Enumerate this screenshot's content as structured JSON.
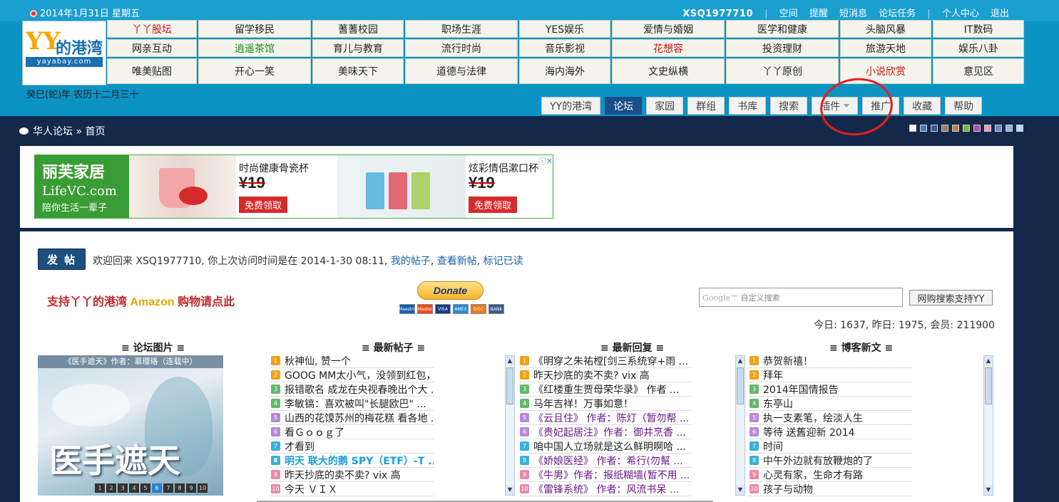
{
  "header": {
    "date": "2014年1月31日 星期五",
    "lunar": "癸巳(蛇)年 农历十二月三十",
    "username": "XSQ1977710",
    "top_links": [
      "空间",
      "提醒",
      "短消息",
      "论坛任务"
    ],
    "top_links2": [
      "个人中心",
      "退出"
    ],
    "logo": {
      "mark": "YY",
      "text": "的港湾",
      "domain": "yayabay.com"
    }
  },
  "categories": [
    {
      "label": "丫丫股坛",
      "color": "red"
    },
    {
      "label": "留学移民",
      "color": "normal"
    },
    {
      "label": "蓍蓍校园",
      "color": "normal"
    },
    {
      "label": "职场生涯",
      "color": "normal"
    },
    {
      "label": "YES娱乐",
      "color": "normal"
    },
    {
      "label": "爱情与婚姻",
      "color": "normal"
    },
    {
      "label": "医学和健康",
      "color": "normal"
    },
    {
      "label": "头脑风暴",
      "color": "normal"
    },
    {
      "label": "IT数码",
      "color": "normal"
    },
    {
      "label": "网亲互动",
      "color": "normal"
    },
    {
      "label": "逍遥茶馆",
      "color": "green"
    },
    {
      "label": "育儿与教育",
      "color": "normal"
    },
    {
      "label": "流行时尚",
      "color": "normal"
    },
    {
      "label": "音乐影视",
      "color": "normal"
    },
    {
      "label": "花想容",
      "color": "red"
    },
    {
      "label": "投资理财",
      "color": "normal"
    },
    {
      "label": "旅游天地",
      "color": "normal"
    },
    {
      "label": "娱乐八卦",
      "color": "normal"
    },
    {
      "label": "唯美贴图",
      "color": "normal"
    },
    {
      "label": "开心一笑",
      "color": "normal"
    },
    {
      "label": "美味天下",
      "color": "normal"
    },
    {
      "label": "道德与法律",
      "color": "normal"
    },
    {
      "label": "海内海外",
      "color": "normal"
    },
    {
      "label": "文史纵横",
      "color": "normal"
    },
    {
      "label": "丫丫原创",
      "color": "normal"
    },
    {
      "label": "小说欣赏",
      "color": "red"
    },
    {
      "label": "意见区",
      "color": "normal"
    }
  ],
  "nav_tabs": [
    {
      "label": "YY的港湾",
      "active": false
    },
    {
      "label": "论坛",
      "active": true
    },
    {
      "label": "家园",
      "active": false
    },
    {
      "label": "群组",
      "active": false
    },
    {
      "label": "书库",
      "active": false
    },
    {
      "label": "搜索",
      "active": false
    },
    {
      "label": "插件",
      "active": false,
      "dropdown": true
    },
    {
      "label": "推广",
      "active": false
    },
    {
      "label": "收藏",
      "active": false
    },
    {
      "label": "帮助",
      "active": false
    }
  ],
  "breadcrumb": {
    "forum": "华人论坛",
    "sep": "»",
    "page": "首页"
  },
  "style_swatches": [
    "#ffffff",
    "#4a78b8",
    "#3a5a8a",
    "#9a7a5a",
    "#c08040",
    "#7ab830",
    "#b848a8",
    "#e89ab8",
    "#6a8ac8",
    "#8ab8e8",
    "#b8d8f0"
  ],
  "ad": {
    "brand1": "丽芙家居",
    "brand2": "LifeVC.com",
    "slogan": "陪你生活一辈子",
    "item1_title": "时尚健康骨瓷杯",
    "item1_price": "¥19",
    "item2_title": "炫彩情侣漱口杯",
    "item2_price": "¥19",
    "cta": "免费领取",
    "close": "ⓘ✕"
  },
  "welcome": {
    "post_button": "发 帖",
    "text": "欢迎回来 XSQ1977710, 你上次访问时间是在 2014-1-30 08:11,",
    "link_my_posts": "我的帖子",
    "link_new_posts": "查看新帖",
    "link_mark_read": "标记已读"
  },
  "promo": {
    "part1": "支持丫丫的港湾 ",
    "part2": "Amazon",
    "part3": " 购物请点此"
  },
  "donate": {
    "label": "Donate",
    "cards": [
      "Maestro",
      "Master",
      "VISA",
      "AMEX",
      "DISC",
      "BANK"
    ]
  },
  "gsearch": {
    "brand": "Google™",
    "placeholder": "自定义搜索",
    "button": "网购搜索支持YY"
  },
  "stats": "今日: 1637, 昨日: 1975, 会员: 211900",
  "columns": {
    "pics_title": "≡ 论坛图片 ≡",
    "new_posts_title": "≡ 最新帖子 ≡",
    "new_replies_title": "≡ 最新回复 ≡",
    "blog_title": "≡ 博客新文 ≡"
  },
  "pic": {
    "caption": "《医手遮天》作者：慕璎珞（连载中）",
    "title": "医手遮天",
    "pages": [
      "1",
      "2",
      "3",
      "4",
      "5",
      "6",
      "7",
      "8",
      "9",
      "10"
    ],
    "active_page": 6
  },
  "num_colors": [
    "#f2a11a",
    "#f2a11a",
    "#65b86a",
    "#65b86a",
    "#b88ad8",
    "#b88ad8",
    "#3ab0d8",
    "#3ab0d8",
    "#e88aa8",
    "#e88aa8"
  ],
  "new_posts": [
    {
      "n": "1",
      "text": "秋神仙,   赞一个",
      "style": "normal"
    },
    {
      "n": "2",
      "text": "GOOG MM太小气，没领到红包，给 ...",
      "style": "normal"
    },
    {
      "n": "3",
      "text": "报错歌名 成龙在央视春晚出个大 ...",
      "style": "normal"
    },
    {
      "n": "4",
      "text": "李敏镐：喜欢被叫\"长腿欧巴\" ...",
      "style": "normal"
    },
    {
      "n": "5",
      "text": "山西的花馍苏州的梅花糕 看各地 ...",
      "style": "normal"
    },
    {
      "n": "6",
      "text": "看Ｇｏｏｇ了",
      "style": "normal"
    },
    {
      "n": "7",
      "text": "才看到",
      "style": "normal"
    },
    {
      "n": "8",
      "text": "明天  联大的鹅  SPY（ETF）-T ...",
      "style": "bold"
    },
    {
      "n": "9",
      "text": "昨天抄底的卖不卖?  vix 高",
      "style": "normal"
    },
    {
      "n": "10",
      "text": "今天  ＶＩＸ",
      "style": "normal"
    }
  ],
  "new_replies": [
    {
      "n": "1",
      "text": "《明穿之朱祐樘[剑三系统穿+雨 ...",
      "style": "normal"
    },
    {
      "n": "2",
      "text": "昨天抄底的卖不卖?  vix 高",
      "style": "normal"
    },
    {
      "n": "3",
      "text": "《红楼重生贾母荣华录》 作者 ...",
      "style": "normal"
    },
    {
      "n": "4",
      "text": "马年吉祥！万事如意！",
      "style": "normal"
    },
    {
      "n": "5",
      "text": "《云且住》 作者：陈灯（暂勿帮 ...",
      "style": "purple"
    },
    {
      "n": "6",
      "text": "《贵妃起居注》作者：御井烹香 ...",
      "style": "purple"
    },
    {
      "n": "7",
      "text": "咱中国人立场就是这么鲜明啊哈 ...",
      "style": "normal"
    },
    {
      "n": "8",
      "text": "《娇娘医经》 作者：希行(勿幫 ...",
      "style": "purple"
    },
    {
      "n": "9",
      "text": "《牛男》作者：报纸糊墙(暂不用 ...",
      "style": "purple"
    },
    {
      "n": "10",
      "text": "《雷锋系统》 作者：风流书呆 ...",
      "style": "purple"
    }
  ],
  "blog_posts": [
    {
      "n": "1",
      "text": "恭贺新禧！",
      "style": "normal"
    },
    {
      "n": "2",
      "text": "拜年",
      "style": "normal"
    },
    {
      "n": "3",
      "text": "2014年国情报告",
      "style": "normal"
    },
    {
      "n": "4",
      "text": "东亭山",
      "style": "normal"
    },
    {
      "n": "5",
      "text": "执一支素笔，绘淡人生",
      "style": "normal"
    },
    {
      "n": "6",
      "text": "等待 送舊迎新 2014",
      "style": "normal"
    },
    {
      "n": "7",
      "text": "时间",
      "style": "normal"
    },
    {
      "n": "8",
      "text": "中午外边就有放鞭炮的了",
      "style": "normal"
    },
    {
      "n": "9",
      "text": "心灵有家，生命才有路",
      "style": "normal"
    },
    {
      "n": "10",
      "text": "孩子与动物",
      "style": "normal"
    }
  ]
}
